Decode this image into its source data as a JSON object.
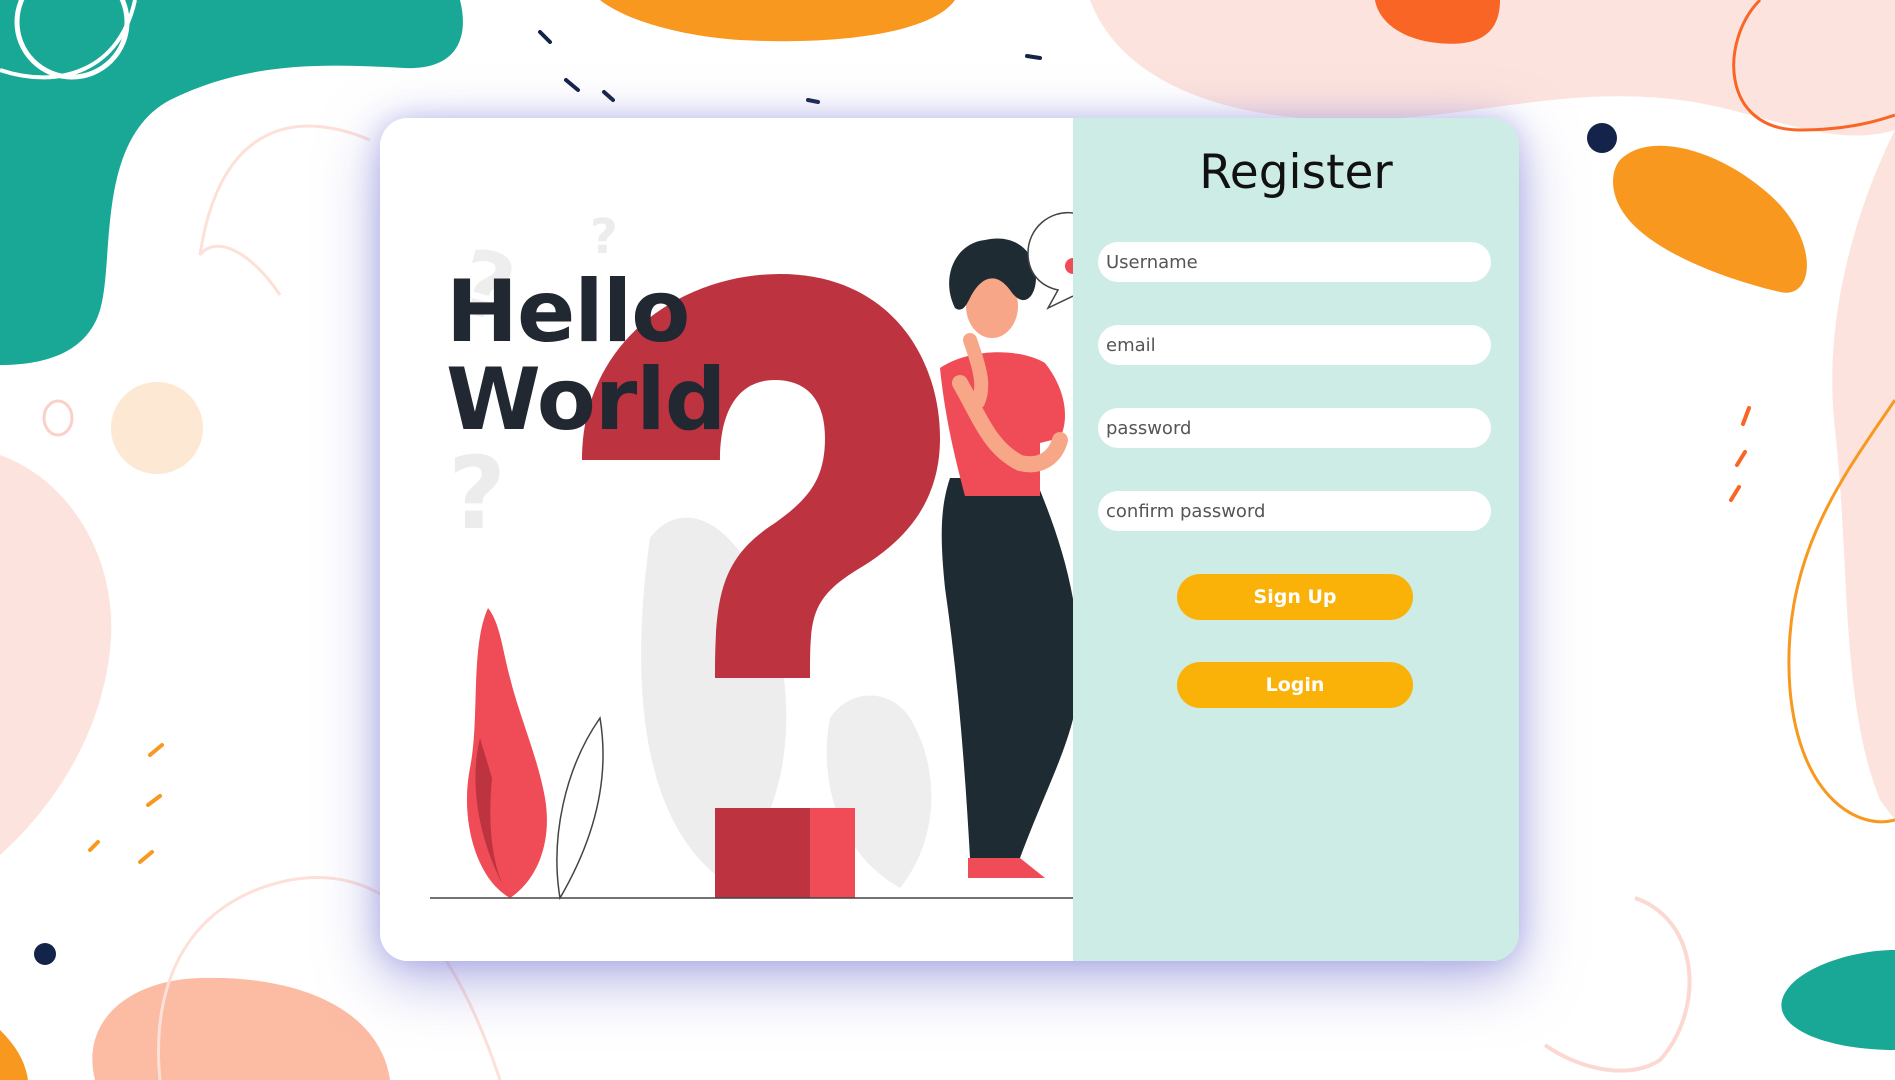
{
  "colors": {
    "card_shadow": "#7876d2",
    "form_background": "#cdece5",
    "button_background": "#fbb208",
    "button_text": "#ffffff",
    "question_mark_red": "#bd3340",
    "accent_red": "#f04c57",
    "teal_blob": "#18a895",
    "orange_blob": "#f8981f",
    "peach_blob": "#fde3dd"
  },
  "illustration": {
    "heading_line_1": "Hello",
    "heading_line_2": "World",
    "icons": [
      "question-mark",
      "thinking-person",
      "speech-bubble",
      "plant",
      "leaf"
    ]
  },
  "form": {
    "title": "Register",
    "username_placeholder": "Username",
    "email_placeholder": "email",
    "password_placeholder": "password",
    "confirm_password_placeholder": "confirm password",
    "signup_label": "Sign Up",
    "login_label": "Login"
  }
}
